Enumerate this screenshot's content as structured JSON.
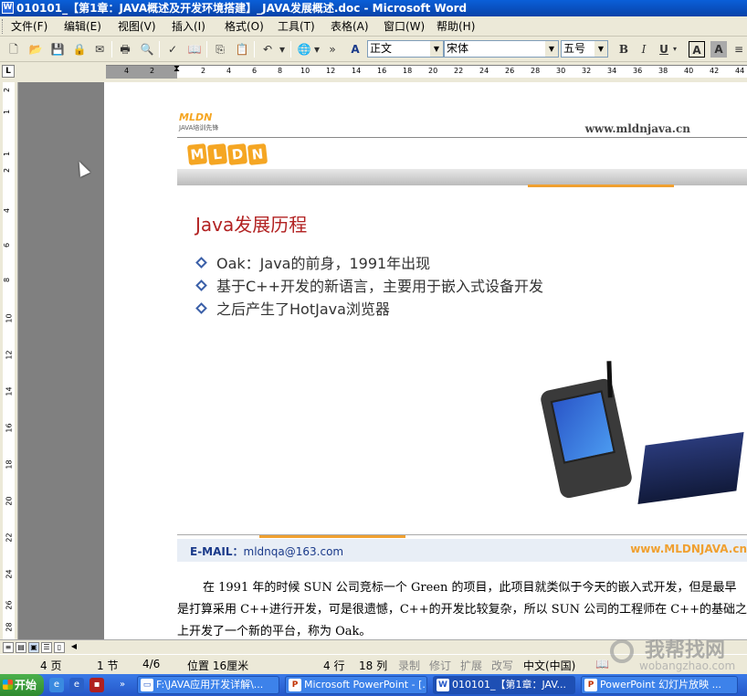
{
  "window": {
    "title": "010101_【第1章：JAVA概述及开发环境搭建】_JAVA发展概述.doc - Microsoft Word"
  },
  "menubar": {
    "items": [
      "文件(F)",
      "编辑(E)",
      "视图(V)",
      "插入(I)",
      "格式(O)",
      "工具(T)",
      "表格(A)",
      "窗口(W)",
      "帮助(H)"
    ]
  },
  "toolbar": {
    "style_combo": "正文",
    "font_combo": "宋体",
    "size_combo": "五号",
    "bold": "B",
    "italic": "I",
    "underline": "U",
    "border_a": "A",
    "shade_a": "A",
    "style_icon": "A"
  },
  "ruler": {
    "corner": "L",
    "left_numbers": [
      "4",
      "2"
    ],
    "numbers": [
      "2",
      "4",
      "6",
      "8",
      "10",
      "12",
      "14",
      "16",
      "18",
      "20",
      "22",
      "24",
      "26",
      "28",
      "30",
      "32",
      "34",
      "36",
      "38",
      "40",
      "42",
      "44"
    ],
    "vnumbers": [
      "2",
      "1",
      "1",
      "2",
      "4",
      "6",
      "8",
      "10",
      "12",
      "14",
      "16",
      "18",
      "20",
      "22",
      "24",
      "26",
      "28"
    ]
  },
  "slide": {
    "logo_small_text": "MLDN",
    "logo_small_sub": "JAVA培训先锋",
    "logo_big_text": [
      "M",
      "L",
      "D",
      "N"
    ],
    "url_top": "www.mldnjava.cn",
    "title": "Java发展历程",
    "bullets": [
      "Oak：Java的前身，1991年出现",
      "基于C++开发的新语言，主要用于嵌入式设备开发",
      "之后产生了HotJava浏览器"
    ],
    "email_label": "E-MAIL：",
    "email_value": "mldnqa@163.com",
    "url_foot": "www.MLDNJAVA.cn"
  },
  "document": {
    "paragraph_lines": [
      "在 1991 年的时候 SUN 公司竞标一个 Green 的项目，此项目就类似于今天的嵌入式开发，但是最早",
      "是打算采用 C++进行开发，可是很遗憾，C++的开发比较复杂，所以 SUN 公司的工程师在 C++的基础之",
      "上开发了一个新的平台，称为 Oak。"
    ]
  },
  "statusbar": {
    "page": "4 页",
    "section": "1 节",
    "pages": "4/6",
    "position": "位置 16厘米",
    "line": "4 行",
    "col": "18 列",
    "rec": "录制",
    "trk": "修订",
    "ext": "扩展",
    "ovr": "改写",
    "lang": "中文(中国)"
  },
  "taskbar": {
    "start": "开始",
    "tasks": [
      "F:\\JAVA应用开发详解\\...",
      "Microsoft PowerPoint - [...",
      "010101_【第1章：JAV...",
      "PowerPoint 幻灯片放映 ..."
    ]
  },
  "watermark": {
    "text": "我帮找网",
    "sub": "wobangzhao.com"
  },
  "colors": {
    "accent": "#0a5fd8",
    "slide_title": "#b22222",
    "orange": "#f0a030",
    "bullet": "#3a5fa8"
  }
}
